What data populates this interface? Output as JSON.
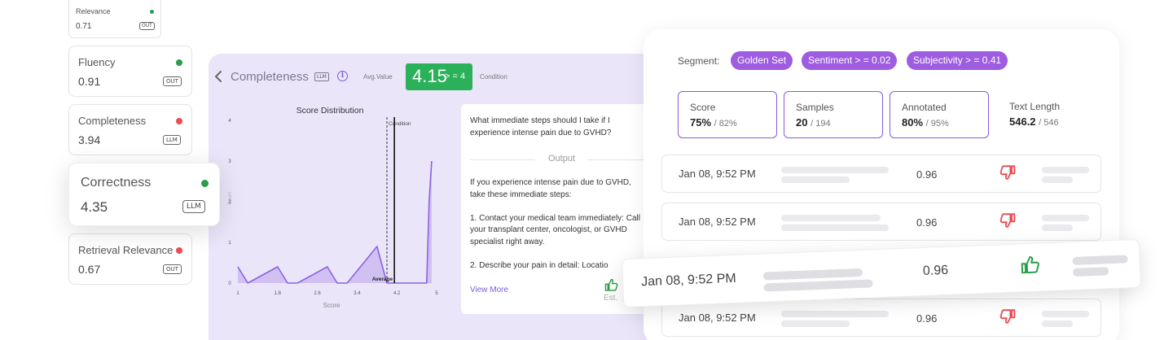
{
  "metric_cards": {
    "relevance": {
      "name": "Relevance",
      "value": "0.71",
      "tag": "OUT",
      "status_color": "#2a9d49"
    },
    "fluency": {
      "name": "Fluency",
      "value": "0.91",
      "tag": "OUT",
      "status_color": "#2a9d49"
    },
    "completeness": {
      "name": "Completeness",
      "value": "3.94",
      "tag": "LLM",
      "status_color": "#ec4c52"
    },
    "correctness": {
      "name": "Correctness",
      "value": "4.35",
      "tag": "LLM",
      "status_color": "#2a9d49"
    },
    "retrieval_relevance": {
      "name": "Retrieval Relevance",
      "value": "0.67",
      "tag": "OUT",
      "status_color": "#ec4c52"
    }
  },
  "completeness_panel": {
    "back_icon": "chevron-left-icon",
    "title": "Completeness",
    "llm_tag": "LLM",
    "info_icon": "info-icon",
    "avg_label": "Avg.Value",
    "avg_value": "4.15",
    "avg_condition": "> = 4",
    "condition_label": "Condition",
    "question": "What immediate steps should I take if I experience intense pain due to GVHD?",
    "output_label": "Output",
    "answer_paragraphs": [
      "If you experience intense pain due to GVHD, take these immediate steps:",
      "1. Contact your medical team immediately: Call your transplant center, oncologist, or GVHD specialist right away.",
      "2. Describe your pain in detail: Locatio"
    ],
    "view_more": "View More",
    "est_label": "Est.",
    "thumb_icon": "thumbs-up-icon",
    "colors": {
      "accent": "#7c5cdb",
      "pass": "#2bb15a",
      "panel_bg": "#ebe5fa"
    }
  },
  "chart_data": {
    "type": "line",
    "title": "Score Distribution",
    "xlabel": "Score",
    "ylabel": "Count",
    "x_ticks": [
      "1",
      "1.8",
      "2.6",
      "3.4",
      "4.2",
      "5"
    ],
    "y_ticks": [
      "0",
      "1",
      "2",
      "3",
      "4"
    ],
    "xlim": [
      1,
      5
    ],
    "ylim": [
      0,
      4
    ],
    "x": [
      1.0,
      1.2,
      1.8,
      2.0,
      2.2,
      2.8,
      3.0,
      3.2,
      3.8,
      4.0,
      4.2,
      4.35,
      4.6,
      4.8,
      4.85,
      4.9
    ],
    "y": [
      0.4,
      0,
      0.4,
      0,
      0,
      0.4,
      0,
      0,
      0.9,
      0,
      0,
      0,
      0,
      0,
      2.0,
      3.0
    ],
    "annotations": [
      {
        "label": "Condition",
        "x": 4.0
      },
      {
        "label": "Average",
        "x": 4.15
      }
    ],
    "color": "#9d7fe3"
  },
  "segment_panel": {
    "segment_label": "Segment:",
    "chips": [
      "Golden Set",
      "Sentiment > = 0.02",
      "Subjectivity > = 0.41"
    ],
    "chip_color": "#9e5ce0",
    "stats": [
      {
        "title": "Score",
        "value": "75%",
        "total": "/ 82%"
      },
      {
        "title": "Samples",
        "value": "20",
        "total": "/ 194"
      },
      {
        "title": "Annotated",
        "value": "80%",
        "total": "/ 95%"
      },
      {
        "title": "Text Length",
        "value": "546.2",
        "total": "/ 546"
      }
    ],
    "rows": [
      {
        "date": "Jan 08, 9:52 PM",
        "value": "0.96",
        "feedback": "thumbs-down-icon"
      },
      {
        "date": "Jan 08, 9:52 PM",
        "value": "0.96",
        "feedback": "thumbs-down-icon"
      },
      {
        "date": "Jan 08, 9:52 PM",
        "value": "0.96",
        "feedback": "thumbs-up-icon"
      },
      {
        "date": "Jan 08, 9:52 PM",
        "value": "0.96",
        "feedback": "thumbs-down-icon"
      }
    ],
    "colors": {
      "thumb_down": "#ec4c52",
      "thumb_up": "#2a9d49"
    }
  }
}
